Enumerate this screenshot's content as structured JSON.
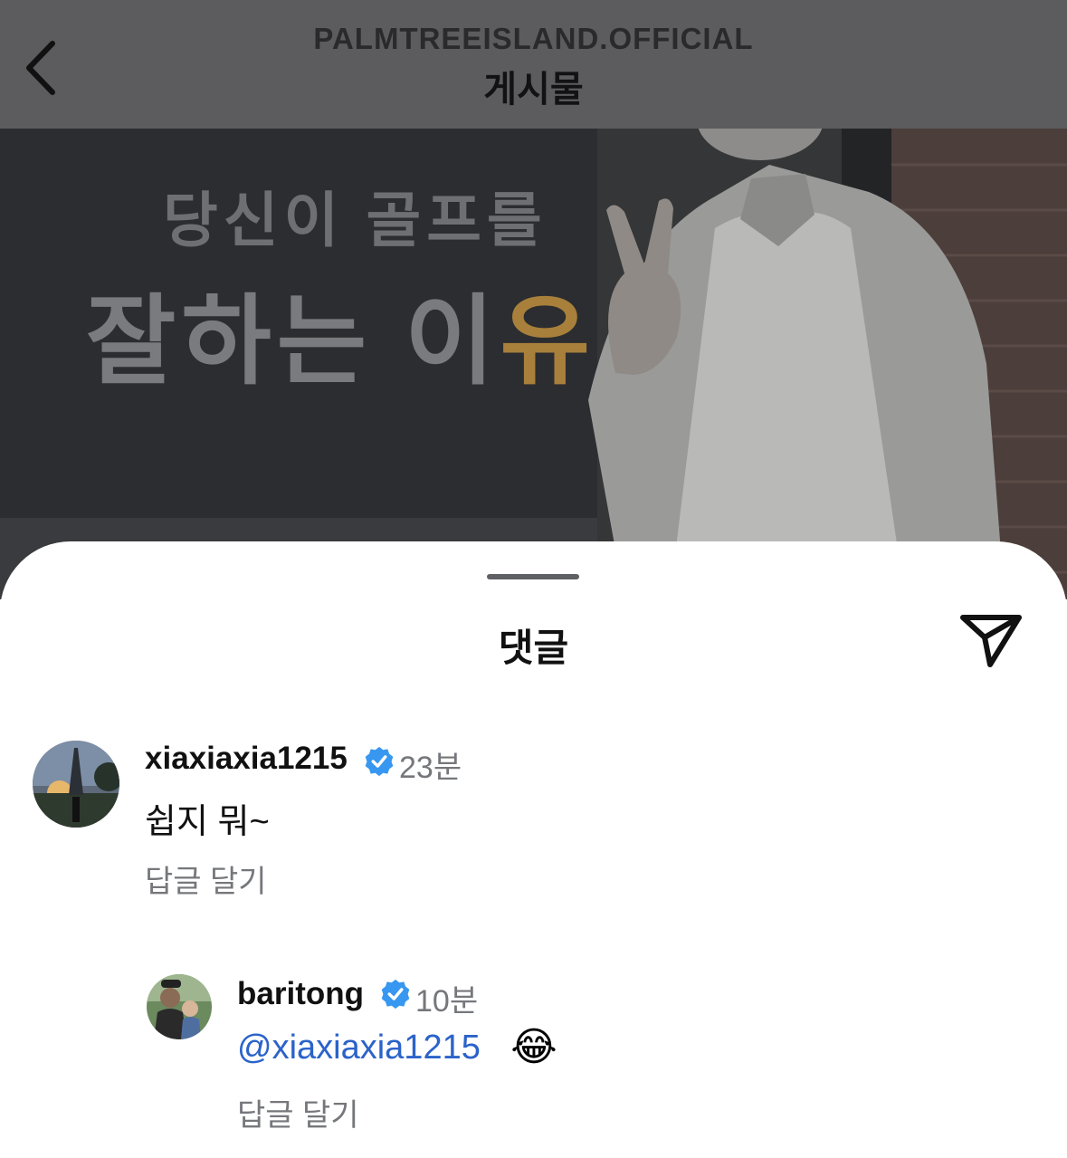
{
  "header": {
    "account": "PALMTREEISLAND.OFFICIAL",
    "title": "게시물"
  },
  "post": {
    "banner_line1": "당신이 골프를",
    "banner_line2_main": "잘하는 이",
    "banner_line2_accent": "유"
  },
  "sheet": {
    "title": "댓글"
  },
  "comments": [
    {
      "username": "xiaxiaxia1215",
      "time": "23분",
      "text": "쉽지 뭐~",
      "reply_label": "답글 달기"
    },
    {
      "username": "baritong",
      "time": "10분",
      "mention": "@xiaxiaxia1215",
      "emoji": "😂",
      "reply_label": "답글 달기"
    }
  ],
  "colors": {
    "verified": "#3897f0",
    "mention": "#2b63c9",
    "header_bg": "#5c5c5f"
  }
}
